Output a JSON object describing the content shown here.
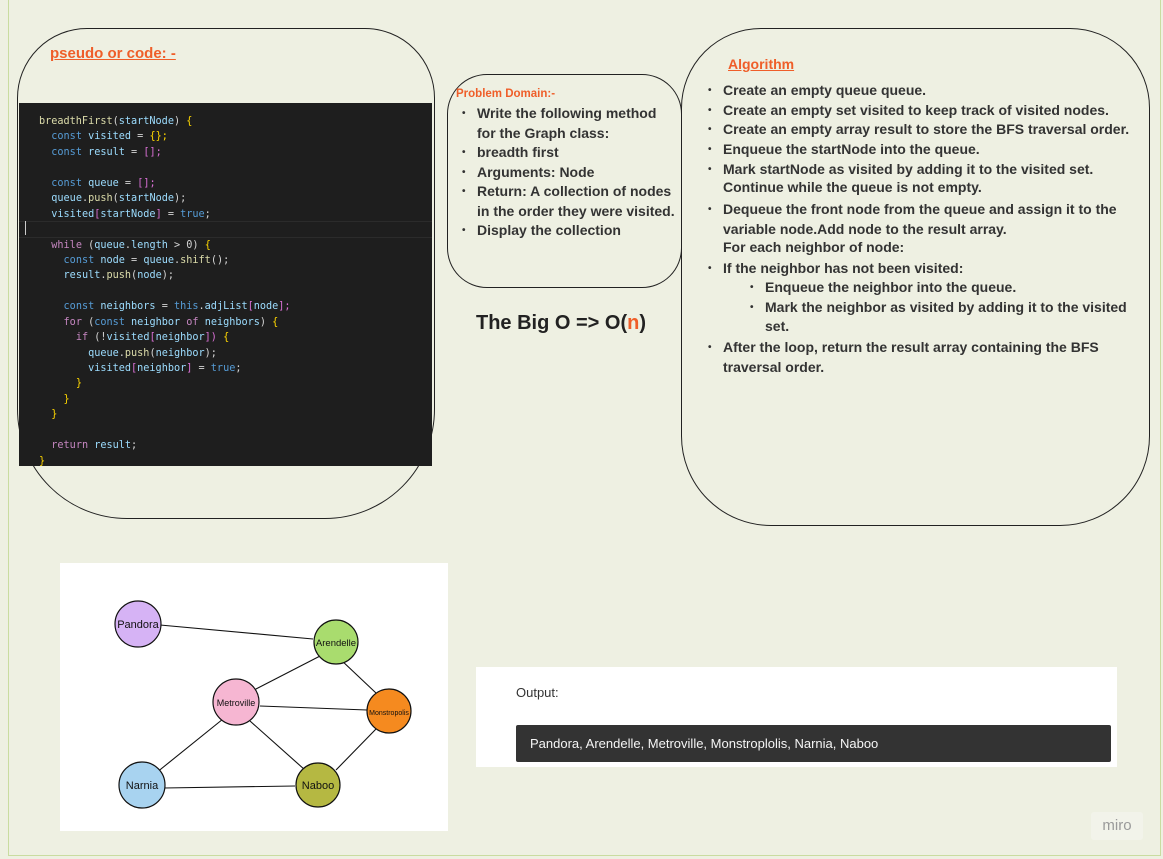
{
  "pseudo_title": "pseudo or code: -",
  "code_lines": [
    "breadthFirst(startNode) {",
    "  const visited = {};",
    "  const result = [];",
    "",
    "  const queue = [];",
    "  queue.push(startNode);",
    "  visited[startNode] = true;",
    "",
    "  while (queue.length > 0) {",
    "    const node = queue.shift();",
    "    result.push(node);",
    "",
    "    const neighbors = this.adjList[node];",
    "    for (const neighbor of neighbors) {",
    "      if (!visited[neighbor]) {",
    "        queue.push(neighbor);",
    "        visited[neighbor] = true;",
    "      }",
    "    }",
    "  }",
    "",
    "  return result;",
    "}"
  ],
  "problem_domain": {
    "title": "Problem Domain:-",
    "items": [
      "Write the following method for the Graph class:",
      "breadth first",
      "Arguments: Node",
      "Return: A collection of nodes in the order they were visited.",
      "Display the collection"
    ]
  },
  "big_o": {
    "prefix": "The Big O => O(",
    "n": "n",
    "suffix": ")"
  },
  "algorithm": {
    "title": "Algorithm",
    "items": [
      "Create an empty queue queue.",
      "Create an empty set visited to keep track of visited nodes.",
      "Create an empty array result to store the BFS traversal order.",
      "Enqueue the startNode into the queue.",
      "Mark startNode as visited by adding it to the visited set."
    ],
    "cont_1": "Continue while the queue is not empty.",
    "item_dequeue": "Dequeue the front node from the queue and assign it to the variable node.Add node to the result array.",
    "cont_2": "For each neighbor of node:",
    "item_if": "If the neighbor has not been visited:",
    "sub_items": [
      "Enqueue the neighbor into the queue.",
      "Mark the neighbor as visited by adding it to the visited set."
    ],
    "item_after": "After the loop, return the result array containing the BFS traversal order."
  },
  "graph": {
    "nodes": [
      {
        "label": "Pandora",
        "color": "#d6b3f5"
      },
      {
        "label": "Arendelle",
        "color": "#a9dc6e"
      },
      {
        "label": "Metroville",
        "color": "#f6b6d2"
      },
      {
        "label": "Monstropolis",
        "color": "#f58a1f"
      },
      {
        "label": "Narnia",
        "color": "#a8d3f0"
      },
      {
        "label": "Naboo",
        "color": "#b5b842"
      }
    ]
  },
  "output": {
    "label": "Output:",
    "result": "Pandora, Arendelle, Metroville, Monstroplolis, Narnia, Naboo"
  },
  "watermark": "miro"
}
